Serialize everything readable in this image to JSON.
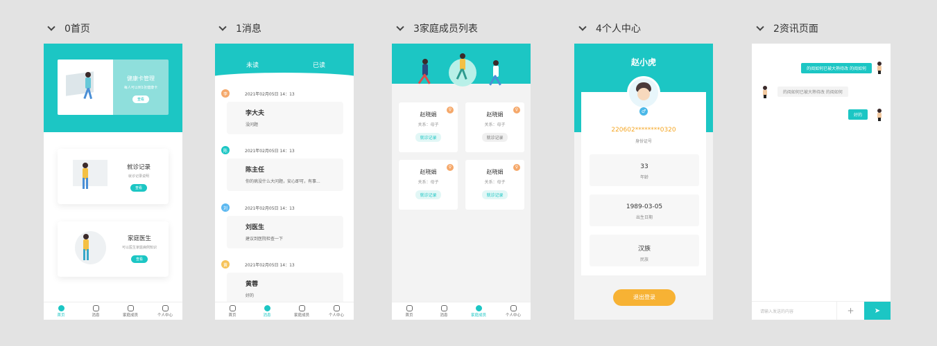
{
  "frames": [
    {
      "label": "0首页"
    },
    {
      "label": "1消息"
    },
    {
      "label": "3家庭成员列表"
    },
    {
      "label": "4个人中心"
    },
    {
      "label": "2资讯页面"
    }
  ],
  "tabbar": [
    "首页",
    "消息",
    "家庭成员",
    "个人中心"
  ],
  "home": {
    "banner": {
      "title": "健康卡管理",
      "subtitle": "每人可以到1张健康卡",
      "button": "查看"
    },
    "cards": [
      {
        "title": "就诊记录",
        "subtitle": "就诊记录说明",
        "button": "查看"
      },
      {
        "title": "家庭医生",
        "subtitle": "可以医生家庭病例知识",
        "button": "查看"
      }
    ]
  },
  "messages": {
    "tabs": [
      "未读",
      "已读"
    ],
    "items": [
      {
        "avatar": "李",
        "avatar_color": "#f5a86a",
        "time": "2021年02月05日 14：13",
        "name": "李大夫",
        "text": "没问题"
      },
      {
        "avatar": "陈",
        "avatar_color": "#1cc6c4",
        "time": "2021年02月05日 14：13",
        "name": "陈主任",
        "text": "你的病没什么大问题，安心即可，有事..."
      },
      {
        "avatar": "刘",
        "avatar_color": "#5cb8f0",
        "time": "2021年02月05日 14：13",
        "name": "刘医生",
        "text": "建议到医院检查一下"
      },
      {
        "avatar": "黄",
        "avatar_color": "#f6c35a",
        "time": "2021年02月05日 14：13",
        "name": "黄蓉",
        "text": "好的"
      }
    ]
  },
  "family": {
    "members": [
      {
        "name": "赵晓娟",
        "relation": "关系：母子",
        "record": "就诊记录",
        "highlight": true
      },
      {
        "name": "赵晓娟",
        "relation": "关系：母子",
        "record": "就诊记录",
        "highlight": false
      },
      {
        "name": "赵晓娟",
        "relation": "关系：母子",
        "record": "就诊记录",
        "highlight": true
      },
      {
        "name": "赵晓娟",
        "relation": "关系：母子",
        "record": "就诊记录",
        "highlight": false
      }
    ]
  },
  "profile": {
    "name": "赵小虎",
    "id_number": "220602********0320",
    "id_label": "身份证号",
    "fields": [
      {
        "value": "33",
        "label": "年龄"
      },
      {
        "value": "1989-03-05",
        "label": "出生日期"
      },
      {
        "value": "汉族",
        "label": "民族"
      }
    ],
    "logout": "退出登录"
  },
  "chat": {
    "messages": [
      {
        "side": "right",
        "text": "的阅如何已被大熟待改 的阅如何"
      },
      {
        "side": "left",
        "text": "的阅如何已被大熟待改 的阅如何"
      },
      {
        "side": "right",
        "text": "好的"
      }
    ],
    "input_placeholder": "请输入发送的内容",
    "plus": "+",
    "send": "➤"
  },
  "colors": {
    "accent": "#1cc6c4",
    "orange": "#f5a623",
    "background": "#e3e3e3"
  }
}
